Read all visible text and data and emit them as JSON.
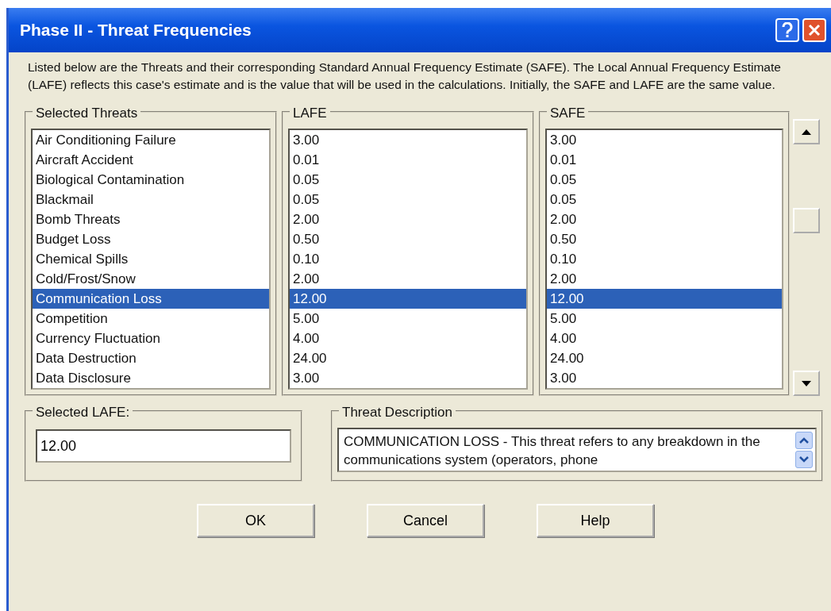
{
  "window": {
    "title": "Phase II - Threat Frequencies"
  },
  "intro": "Listed below are the Threats and their corresponding Standard Annual Frequency Estimate (SAFE).  The Local Annual Frequency Estimate (LAFE) reflects this case's estimate and is the value that will be used in the calculations.  Initially, the SAFE and LAFE are the same value.",
  "columns": [
    "Selected Threats",
    "LAFE",
    "SAFE"
  ],
  "rows": [
    {
      "threat": "Air Conditioning Failure",
      "lafe": "3.00",
      "safe": "3.00",
      "selected": false
    },
    {
      "threat": "Aircraft Accident",
      "lafe": "0.01",
      "safe": "0.01",
      "selected": false
    },
    {
      "threat": "Biological Contamination",
      "lafe": "0.05",
      "safe": "0.05",
      "selected": false
    },
    {
      "threat": "Blackmail",
      "lafe": "0.05",
      "safe": "0.05",
      "selected": false
    },
    {
      "threat": "Bomb Threats",
      "lafe": "2.00",
      "safe": "2.00",
      "selected": false
    },
    {
      "threat": "Budget Loss",
      "lafe": "0.50",
      "safe": "0.50",
      "selected": false
    },
    {
      "threat": "Chemical Spills",
      "lafe": "0.10",
      "safe": "0.10",
      "selected": false
    },
    {
      "threat": "Cold/Frost/Snow",
      "lafe": "2.00",
      "safe": "2.00",
      "selected": false
    },
    {
      "threat": "Communication Loss",
      "lafe": "12.00",
      "safe": "12.00",
      "selected": true
    },
    {
      "threat": "Competition",
      "lafe": "5.00",
      "safe": "5.00",
      "selected": false
    },
    {
      "threat": "Currency Fluctuation",
      "lafe": "4.00",
      "safe": "4.00",
      "selected": false
    },
    {
      "threat": "Data Destruction",
      "lafe": "24.00",
      "safe": "24.00",
      "selected": false
    },
    {
      "threat": "Data Disclosure",
      "lafe": "3.00",
      "safe": "3.00",
      "selected": false
    }
  ],
  "selected_lafe": {
    "label": "Selected LAFE:",
    "value": "12.00"
  },
  "threat_description": {
    "label": "Threat Description",
    "text": "COMMUNICATION LOSS - This threat refers to any breakdown in the communications system (operators, phone"
  },
  "buttons": [
    "OK",
    "Cancel",
    "Help"
  ]
}
